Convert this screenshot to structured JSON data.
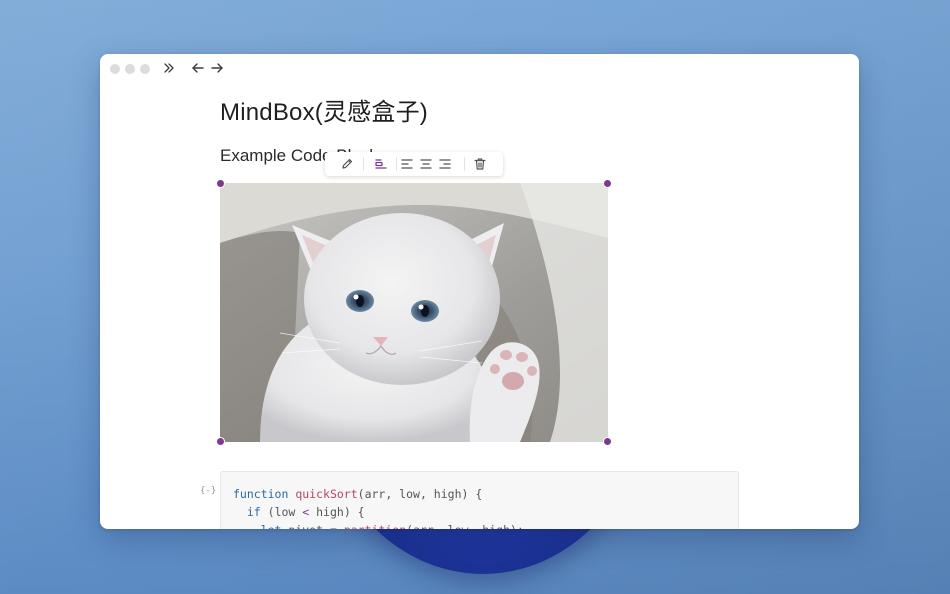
{
  "colors": {
    "accent": "#7b3a8c",
    "desktop_blue": "#6e9dd0",
    "window_bg": "#ffffff",
    "code_bg": "#f7f7f7"
  },
  "titlebar": {
    "icons": [
      "sidebar-toggle-icon",
      "arrow-left-icon",
      "arrow-right-icon"
    ]
  },
  "document": {
    "title": "MindBox(灵感盒子)",
    "heading": "Example Code Block"
  },
  "image_toolbar": {
    "buttons": [
      "edit-icon",
      "align-inline-icon",
      "align-left-icon",
      "align-center-icon",
      "align-right-icon",
      "delete-icon"
    ],
    "active": "align-inline-icon"
  },
  "image": {
    "subject": "white kitten"
  },
  "code": {
    "fold_marker": "{-}",
    "lines": [
      [
        {
          "t": "function",
          "c": "kw"
        },
        {
          "t": " ",
          "c": "plain"
        },
        {
          "t": "quickSort",
          "c": "fn"
        },
        {
          "t": "(arr, low, high) {",
          "c": "plain"
        }
      ],
      [
        {
          "t": "  ",
          "c": "plain"
        },
        {
          "t": "if",
          "c": "kw"
        },
        {
          "t": " (low ",
          "c": "plain"
        },
        {
          "t": "<",
          "c": "op"
        },
        {
          "t": " high) {",
          "c": "plain"
        }
      ],
      [
        {
          "t": "    ",
          "c": "plain"
        },
        {
          "t": "let",
          "c": "kw"
        },
        {
          "t": " pivot ",
          "c": "plain"
        },
        {
          "t": "=",
          "c": "op"
        },
        {
          "t": " ",
          "c": "plain"
        },
        {
          "t": "partition",
          "c": "fn"
        },
        {
          "t": "(arr, low, high);",
          "c": "plain"
        }
      ]
    ]
  }
}
